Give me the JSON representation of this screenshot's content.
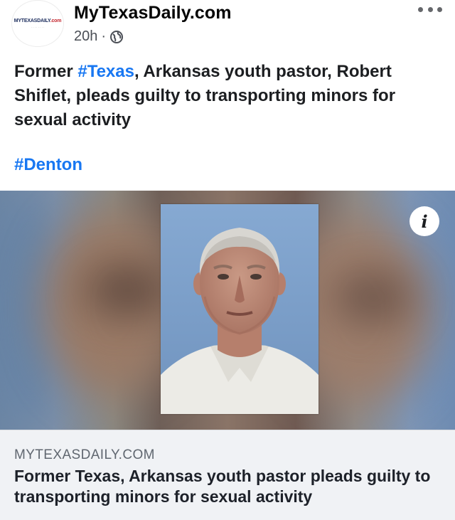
{
  "post": {
    "avatar_logo_text": "MYTEXASDAILY",
    "avatar_logo_suffix": ".com",
    "page_name": "MyTexasDaily.com",
    "timestamp": "20h",
    "separator": "·",
    "privacy_icon": "globe-icon",
    "more_icon": "more-options-icon",
    "text_part1": "Former ",
    "text_hashtag": "#Texas",
    "text_part2": ", Arkansas youth pastor, Robert Shiflet, pleads guilty to transporting minors for sexual activity",
    "hashtag_line": "#Denton"
  },
  "link_preview": {
    "info_icon": "info-icon",
    "info_glyph": "i",
    "domain": "MYTEXASDAILY.COM",
    "title": "Former Texas, Arkansas youth pastor pleads guilty to transporting minors for sexual activity"
  },
  "colors": {
    "hashtag": "#1877f2",
    "caption_bg": "#f0f2f5",
    "text": "#1c1e21",
    "meta": "#4b4f56"
  }
}
